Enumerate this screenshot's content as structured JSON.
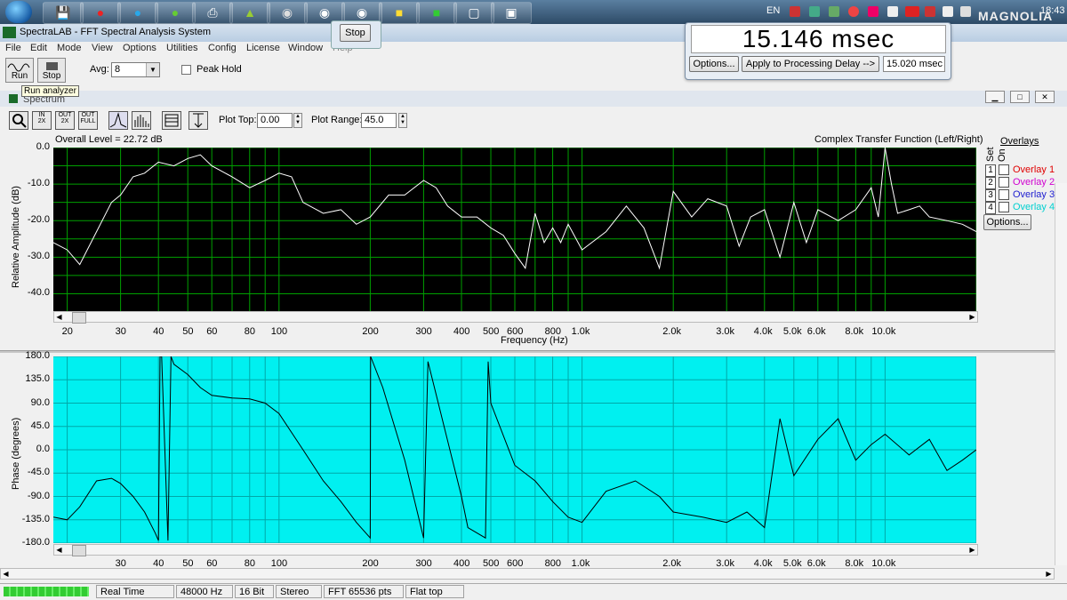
{
  "taskbar": {
    "lang": "EN",
    "clock": "18:43",
    "watermark": "MAGNOLIA",
    "apps": [
      "save-icon",
      "opera-icon",
      "skype-icon",
      "utorrent-icon",
      "printer-icon",
      "android-icon",
      "wordpress-icon",
      "browser-icon",
      "media-icon",
      "winamp-icon",
      "spectralab-icon",
      "window-icon",
      "monitor-icon"
    ]
  },
  "window": {
    "title": "SpectraLAB - FFT Spectral Analysis System"
  },
  "menu": [
    "File",
    "Edit",
    "Mode",
    "View",
    "Options",
    "Utilities",
    "Config",
    "License",
    "Window",
    "Help"
  ],
  "toolbar": {
    "run_label": "Run",
    "stop_label": "Stop",
    "avg_label": "Avg:",
    "avg_value": "8",
    "peak_hold_label": "Peak Hold",
    "tooltip": "Run analyzer",
    "float_stop": "Stop"
  },
  "delay": {
    "readout": "15.146 msec",
    "options_label": "Options...",
    "apply_label": "Apply to Processing Delay -->",
    "processing_delay": "15.020 msec"
  },
  "spectrum": {
    "title": "Spectrum",
    "buttons": [
      "zoom-icon",
      "zoom-in-2x-icon",
      "zoom-out-2x-icon",
      "zoom-out-full-icon",
      "line-mode-icon",
      "bar-mode-icon",
      "table-icon",
      "marker-icon"
    ],
    "plot_top_label": "Plot Top:",
    "plot_top_value": "0.00",
    "plot_range_label": "Plot Range:",
    "plot_range_value": "45.0",
    "overall_level": "Overall Level = 22.72 dB",
    "function_label": "Complex Transfer Function (Left/Right)",
    "overlays_title": "Overlays",
    "set_label": "Set",
    "on_label": "On",
    "overlays": [
      {
        "num": "1",
        "name": "Overlay 1",
        "color": "#e00000"
      },
      {
        "num": "2",
        "name": "Overlay 2",
        "color": "#d000d0"
      },
      {
        "num": "3",
        "name": "Overlay 3",
        "color": "#2020d0"
      },
      {
        "num": "4",
        "name": "Overlay 4",
        "color": "#00d0d0"
      }
    ],
    "options_label": "Options..."
  },
  "chart_data": [
    {
      "type": "line",
      "title": "",
      "ylabel": "Relative Amplitude (dB)",
      "xlabel": "Frequency (Hz)",
      "x_scale": "log",
      "xlim": [
        18,
        20000
      ],
      "ylim": [
        -45,
        0
      ],
      "yticks": [
        "0.0",
        "-10.0",
        "-20.0",
        "-30.0",
        "-40.0"
      ],
      "xticks": [
        "20",
        "30",
        "40",
        "50",
        "60",
        "80",
        "100",
        "200",
        "300",
        "400",
        "500",
        "600",
        "800",
        "1.0k",
        "2.0k",
        "3.0k",
        "4.0k",
        "5.0k",
        "6.0k",
        "8.0k",
        "10.0k"
      ],
      "background": "#000000",
      "grid_color": "#00a000",
      "line_color": "#ffffff",
      "series": [
        {
          "x": [
            18,
            20,
            22,
            25,
            28,
            30,
            33,
            36,
            40,
            45,
            50,
            55,
            60,
            70,
            80,
            90,
            100,
            110,
            120,
            140,
            160,
            180,
            200,
            230,
            260,
            300,
            330,
            360,
            400,
            450,
            500,
            550,
            600,
            650,
            700,
            750,
            800,
            850,
            900,
            1000,
            1200,
            1400,
            1600,
            1800,
            2000,
            2300,
            2600,
            3000,
            3300,
            3600,
            4000,
            4500,
            5000,
            5500,
            6000,
            7000,
            8000,
            9000,
            9500,
            10000,
            10500,
            11000,
            12000,
            13000,
            14000,
            16000,
            18000,
            20000
          ],
          "y": [
            -26,
            -28,
            -32,
            -23,
            -15,
            -13,
            -8,
            -7,
            -4,
            -5,
            -3,
            -2,
            -5,
            -8,
            -11,
            -9,
            -7,
            -8,
            -15,
            -18,
            -17,
            -21,
            -19,
            -13,
            -13,
            -9,
            -11,
            -16,
            -19,
            -19,
            -22,
            -24,
            -29,
            -33,
            -18,
            -26,
            -22,
            -26,
            -21,
            -28,
            -23,
            -16,
            -22,
            -33,
            -12,
            -19,
            -14,
            -16,
            -27,
            -19,
            -17,
            -30,
            -15,
            -26,
            -17,
            -20,
            -17,
            -11,
            -19,
            0,
            -10,
            -18,
            -17,
            -16,
            -19,
            -20,
            -21,
            -23
          ]
        }
      ]
    },
    {
      "type": "line",
      "title": "",
      "ylabel": "Phase (degrees)",
      "xlabel": "",
      "x_scale": "log",
      "xlim": [
        18,
        20000
      ],
      "ylim": [
        -180,
        180
      ],
      "yticks": [
        "180.0",
        "135.0",
        "90.0",
        "45.0",
        "0.0",
        "-45.0",
        "-90.0",
        "-135.0",
        "-180.0"
      ],
      "xticks": [
        "30",
        "40",
        "50",
        "60",
        "80",
        "100",
        "200",
        "300",
        "400",
        "500",
        "600",
        "800",
        "1.0k",
        "2.0k",
        "3.0k",
        "4.0k",
        "5.0k",
        "6.0k",
        "8.0k",
        "10.0k"
      ],
      "background": "#00f0f0",
      "grid_color": "#00a8a8",
      "line_color": "#000000",
      "series": [
        {
          "x": [
            18,
            20,
            22,
            25,
            28,
            30,
            33,
            36,
            39,
            40,
            40.5,
            41,
            43,
            44,
            45,
            50,
            55,
            60,
            70,
            80,
            90,
            100,
            120,
            140,
            160,
            180,
            200,
            200.5,
            220,
            260,
            300,
            310,
            400,
            420,
            480,
            490,
            500,
            600,
            700,
            800,
            900,
            1000,
            1200,
            1500,
            1800,
            2000,
            2500,
            3000,
            3500,
            4000,
            4500,
            5000,
            6000,
            7000,
            8000,
            9000,
            10000,
            12000,
            14000,
            16000,
            18000,
            20000
          ],
          "y": [
            -130,
            -135,
            -110,
            -60,
            -55,
            -65,
            -90,
            -120,
            -160,
            -175,
            180,
            180,
            -175,
            180,
            165,
            145,
            120,
            105,
            100,
            98,
            90,
            70,
            0,
            -60,
            -100,
            -140,
            -170,
            180,
            120,
            -20,
            -170,
            170,
            -90,
            -150,
            -170,
            170,
            90,
            -30,
            -60,
            -100,
            -130,
            -140,
            -80,
            -60,
            -90,
            -120,
            -130,
            -140,
            -120,
            -150,
            60,
            -50,
            20,
            60,
            -20,
            10,
            30,
            -10,
            20,
            -40,
            -20,
            0
          ]
        }
      ]
    }
  ],
  "status": {
    "mode": "Real Time",
    "sample_rate": "48000 Hz",
    "bits": "16 Bit",
    "channels": "Stereo",
    "fft_size": "FFT 65536 pts",
    "window": "Flat top"
  }
}
